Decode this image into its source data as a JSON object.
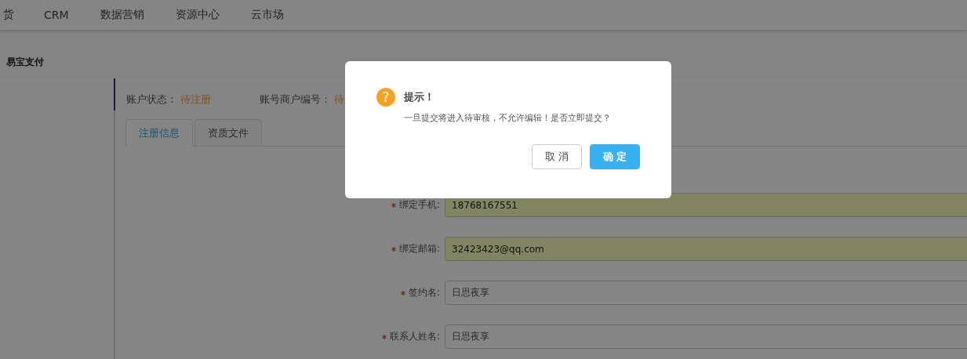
{
  "top_nav": {
    "items": [
      {
        "label": "货"
      },
      {
        "label": "CRM"
      },
      {
        "label": "数据营销"
      },
      {
        "label": "资源中心"
      },
      {
        "label": "云市场"
      }
    ]
  },
  "breadcrumb": "易宝支付",
  "account": {
    "status_label": "账户状态：",
    "status_value": "待注册",
    "merchant_label": "账号商户编号：",
    "merchant_value": "待"
  },
  "tabs": [
    {
      "label": "注册信息",
      "selected": true
    },
    {
      "label": "资质文件",
      "selected": false
    }
  ],
  "form": {
    "fields": [
      {
        "label": "绑定手机:",
        "required": true,
        "value": "18768167551",
        "autofilled": true
      },
      {
        "label": "绑定邮箱:",
        "required": true,
        "value": "32423423@qq.com",
        "autofilled": true
      },
      {
        "label": "签约名:",
        "required": true,
        "value": "日思夜享",
        "autofilled": false
      },
      {
        "label": "联系人姓名:",
        "required": true,
        "value": "日思夜享",
        "autofilled": false
      }
    ]
  },
  "dialog": {
    "icon": "?",
    "title": "提示！",
    "message": "一旦提交将进入待审核，不允许编辑！是否立即提交？",
    "buttons": [
      {
        "label": "取 消",
        "kind": "secondary"
      },
      {
        "label": "确 定",
        "kind": "primary"
      }
    ]
  }
}
